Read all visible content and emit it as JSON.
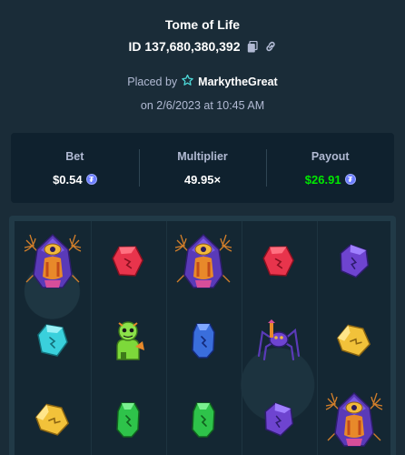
{
  "game": {
    "title": "Tome of Life",
    "bet_id": "ID 137,680,380,392"
  },
  "placement": {
    "prefix": "Placed by",
    "username": "MarkytheGreat",
    "date": "on 2/6/2023 at 10:45 AM"
  },
  "stats": {
    "bet_label": "Bet",
    "bet_value": "$0.54",
    "multiplier_label": "Multiplier",
    "multiplier_value": "49.95×",
    "payout_label": "Payout",
    "payout_value": "$26.91"
  },
  "colors": {
    "background": "#1a2c38",
    "panel": "#0f212e",
    "payout_green": "#00e701",
    "muted_text": "#b1bad3",
    "currency_coin": "#6a7cff"
  },
  "board": {
    "reels": [
      [
        "witch-symbol",
        "cyan-gem",
        "yellow-gem"
      ],
      [
        "red-gem",
        "green-goblin-potion",
        "green-gem"
      ],
      [
        "witch-symbol",
        "blue-gem",
        "green-gem"
      ],
      [
        "red-gem",
        "purple-spider",
        "purple-gem"
      ],
      [
        "purple-gem",
        "yellow-gem",
        "witch-symbol"
      ]
    ]
  }
}
